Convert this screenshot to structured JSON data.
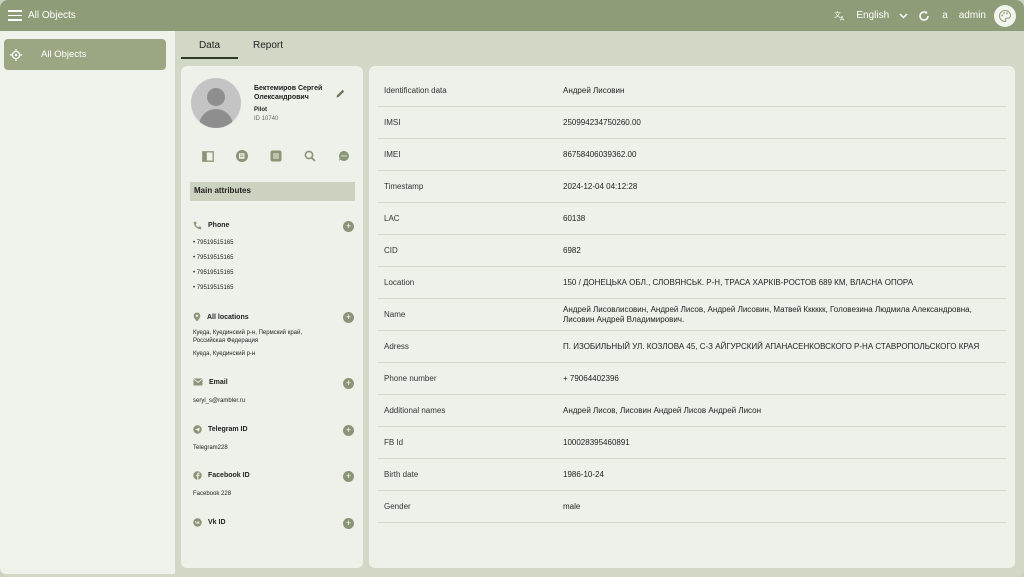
{
  "header": {
    "title": "All Objects",
    "language": "English",
    "user_initial": "a",
    "user_name": "admin"
  },
  "sidebar": {
    "items": [
      {
        "label": "All Objects"
      }
    ]
  },
  "tabs": [
    {
      "label": "Data"
    },
    {
      "label": "Report"
    }
  ],
  "profile": {
    "name": "Бектемиров Сергей Олександрович",
    "role": "Pilot",
    "id_text": "ID 10740",
    "main_attributes_label": "Main attributes",
    "sections": {
      "phone": {
        "title": "Phone",
        "items": [
          "• 79519515165",
          "• 79519515165",
          "• 79519515165",
          "• 79519515165"
        ]
      },
      "locations": {
        "title": "All locations",
        "line1": "Куеда, Куединский р-н, Пермский край,",
        "line2": "Российская Федерация",
        "line3": "Куеда, Куединский р-н"
      },
      "email": {
        "title": "Email",
        "value": "seryi_s@rambler.ru"
      },
      "telegram": {
        "title": "Telegram ID",
        "value": "Telegram228"
      },
      "facebook": {
        "title": "Facebook ID",
        "value": "Facebook 228"
      },
      "vk": {
        "title": "Vk ID"
      }
    }
  },
  "details": [
    {
      "key": "Identification data",
      "value": "Андрей Лисовин"
    },
    {
      "key": "IMSI",
      "value": "250994234750260.00"
    },
    {
      "key": "IMEI",
      "value": "86758406039362.00"
    },
    {
      "key": "Timestamp",
      "value": "2024-12-04 04:12:28"
    },
    {
      "key": "LAC",
      "value": "60138"
    },
    {
      "key": "CID",
      "value": "6982"
    },
    {
      "key": "Location",
      "value": "150 / ДОНЕЦЬКА ОБЛ., СЛОВЯНСЬК. Р-Н, ТРАСА ХАРКІВ-РОСТОВ 689 КМ, ВЛАСНА ОПОРА"
    },
    {
      "key": "Name",
      "value": "Андрей Лисовлисовин, Андрей Лисов, Андрей Лисовин, Матвей Кккккк, Головезина Людмила Александровна, Лисовин Андрей Владимирович."
    },
    {
      "key": "Adress",
      "value": "П. ИЗОБИЛЬНЫЙ УЛ.  КОЗЛОВА 45, С-З АЙГУРСКИЙ АПАНАСЕНКОВСКОГО Р-НА СТАВРОПОЛЬСКОГО КРАЯ"
    },
    {
      "key": "Phone number",
      "value": "+ 79064402396"
    },
    {
      "key": "Additional names",
      "value": "Андрей Лисов, Лисовин Андрей Лисов Андрей Лисон"
    },
    {
      "key": "FB Id",
      "value": "100028395460891"
    },
    {
      "key": "Birth date",
      "value": "1986-10-24"
    },
    {
      "key": "Gender",
      "value": "male"
    }
  ],
  "colors": {
    "topbar": "#8f9c78",
    "accent": "#9aa782",
    "panel": "#eef1e9"
  }
}
